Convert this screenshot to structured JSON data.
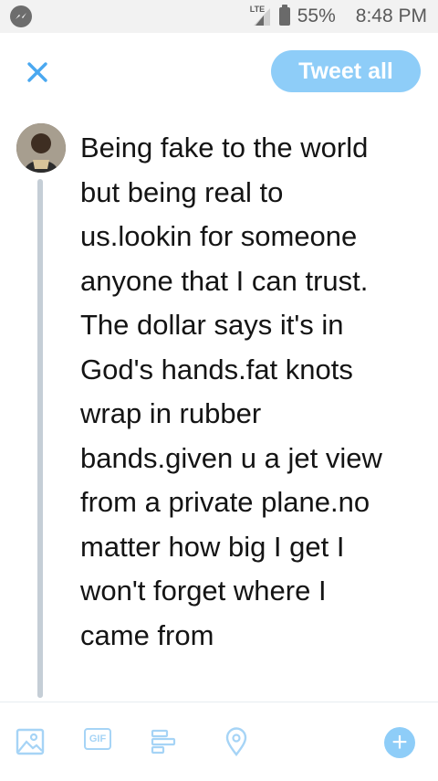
{
  "status_bar": {
    "network": "LTE",
    "battery": "55%",
    "time": "8:48 PM"
  },
  "header": {
    "tweet_all_label": "Tweet all"
  },
  "compose": {
    "text": "Being fake to the world\nbut being real to\nus.lookin for someone\nanyone that I can trust.\nThe dollar says it's in\nGod's hands.fat knots\nwrap in rubber\nbands.given u a jet view\nfrom a private plane.no\nmatter how big I get I\nwon't forget where I\ncame from"
  },
  "toolbar": {
    "gif_label": "GIF",
    "accent_color": "#8ecdf8"
  },
  "icons": [
    "messenger-icon",
    "signal-icon",
    "battery-icon",
    "close-icon",
    "image-icon",
    "gif-icon",
    "poll-icon",
    "location-icon",
    "add-icon"
  ]
}
